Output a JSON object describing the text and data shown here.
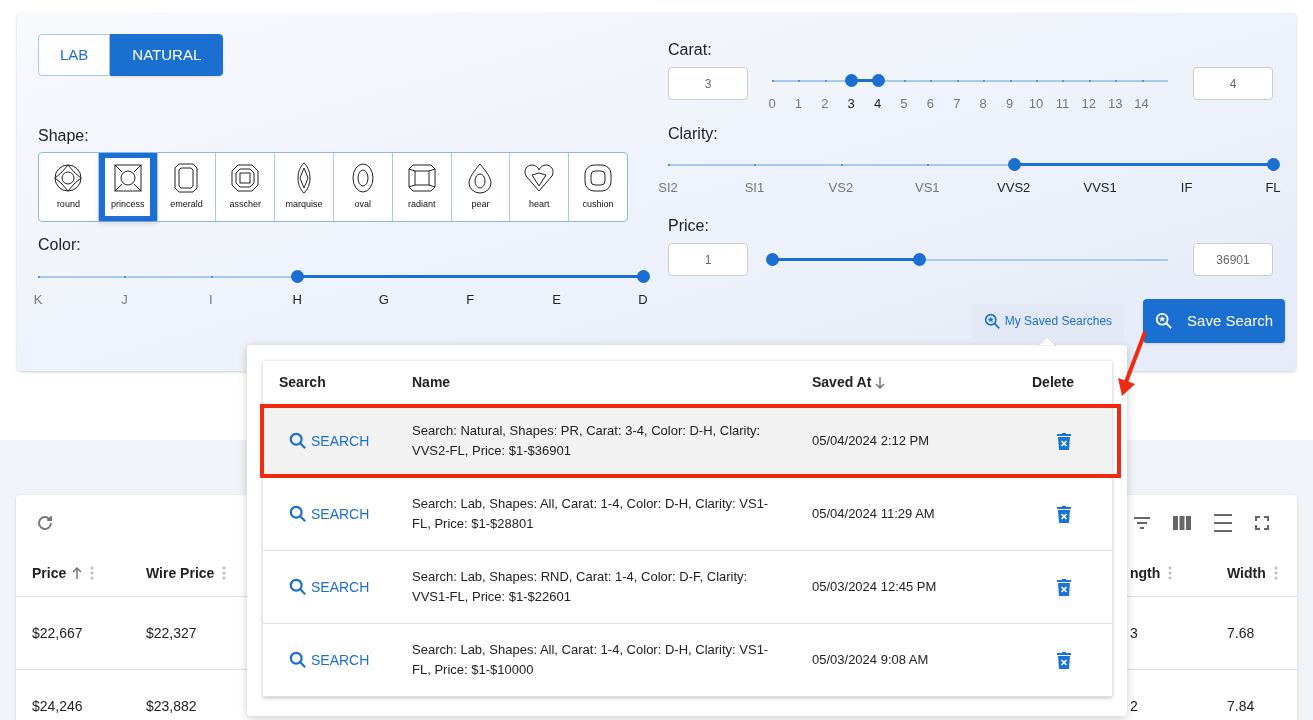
{
  "type_toggle": [
    {
      "label": "LAB",
      "selected": false
    },
    {
      "label": "NATURAL",
      "selected": true
    }
  ],
  "shape": {
    "label": "Shape:",
    "items": [
      {
        "label": "round",
        "kind": "round",
        "selected": false
      },
      {
        "label": "princess",
        "kind": "princess",
        "selected": true
      },
      {
        "label": "emerald",
        "kind": "emerald",
        "selected": false
      },
      {
        "label": "asscher",
        "kind": "asscher",
        "selected": false
      },
      {
        "label": "marquise",
        "kind": "marquise",
        "selected": false
      },
      {
        "label": "oval",
        "kind": "oval",
        "selected": false
      },
      {
        "label": "radiant",
        "kind": "radiant",
        "selected": false
      },
      {
        "label": "pear",
        "kind": "pear",
        "selected": false
      },
      {
        "label": "heart",
        "kind": "heart",
        "selected": false
      },
      {
        "label": "cushion",
        "kind": "cushion",
        "selected": false
      }
    ]
  },
  "color": {
    "label": "Color:",
    "ticks": [
      {
        "label": "K",
        "selected": false
      },
      {
        "label": "J",
        "selected": false
      },
      {
        "label": "I",
        "selected": false
      },
      {
        "label": "H",
        "selected": true
      },
      {
        "label": "G",
        "selected": true
      },
      {
        "label": "F",
        "selected": true
      },
      {
        "label": "E",
        "selected": true
      },
      {
        "label": "D",
        "selected": true
      }
    ]
  },
  "carat": {
    "label": "Carat:",
    "min": "3",
    "max": "4",
    "ticks": [
      {
        "label": "0",
        "selected": false
      },
      {
        "label": "1",
        "selected": false
      },
      {
        "label": "2",
        "selected": false
      },
      {
        "label": "3",
        "selected": true
      },
      {
        "label": "4",
        "selected": true
      },
      {
        "label": "5",
        "selected": false
      },
      {
        "label": "6",
        "selected": false
      },
      {
        "label": "7",
        "selected": false
      },
      {
        "label": "8",
        "selected": false
      },
      {
        "label": "9",
        "selected": false
      },
      {
        "label": "10",
        "selected": false
      },
      {
        "label": "11",
        "selected": false
      },
      {
        "label": "12",
        "selected": false
      },
      {
        "label": "13",
        "selected": false
      },
      {
        "label": "14",
        "selected": false
      }
    ]
  },
  "clarity": {
    "label": "Clarity:",
    "ticks": [
      {
        "label": "SI2",
        "selected": false
      },
      {
        "label": "SI1",
        "selected": false
      },
      {
        "label": "VS2",
        "selected": false
      },
      {
        "label": "VS1",
        "selected": false
      },
      {
        "label": "VVS2",
        "selected": true
      },
      {
        "label": "VVS1",
        "selected": true
      },
      {
        "label": "IF",
        "selected": true
      },
      {
        "label": "FL",
        "selected": true
      }
    ]
  },
  "price": {
    "label": "Price:",
    "min": "1",
    "max": "36901",
    "level": 0.37
  },
  "my_saved_searches": "My Saved Searches",
  "save_search": "Save Search",
  "saved_searches": {
    "columns": [
      "Search",
      "Name",
      "Saved At",
      "Delete"
    ],
    "rows": [
      {
        "action": "SEARCH",
        "name": "Search: Natural, Shapes: PR, Carat: 3-4, Color: D-H, Clarity: VVS2-FL, Price: $1-$36901",
        "saved_at": "05/04/2024 2:12 PM",
        "highlighted": true
      },
      {
        "action": "SEARCH",
        "name": "Search: Lab, Shapes: All, Carat: 1-4, Color: D-H, Clarity: VS1-FL, Price: $1-$28801",
        "saved_at": "05/04/2024 11:29 AM",
        "highlighted": false
      },
      {
        "action": "SEARCH",
        "name": "Search: Lab, Shapes: RND, Carat: 1-4, Color: D-F, Clarity: VVS1-FL, Price: $1-$22601",
        "saved_at": "05/03/2024 12:45 PM",
        "highlighted": false
      },
      {
        "action": "SEARCH",
        "name": "Search: Lab, Shapes: All, Carat: 1-4, Color: D-H, Clarity: VS1-FL, Price: $1-$10000",
        "saved_at": "05/03/2024 9:08 AM",
        "highlighted": false
      }
    ]
  },
  "results": {
    "columns": [
      "Price",
      "Wire Price",
      "ngth",
      "Width"
    ],
    "rows": [
      [
        "$22,667",
        "$22,327",
        "3",
        "7.68"
      ],
      [
        "$24,246",
        "$23,882",
        "2",
        "7.84"
      ]
    ]
  }
}
